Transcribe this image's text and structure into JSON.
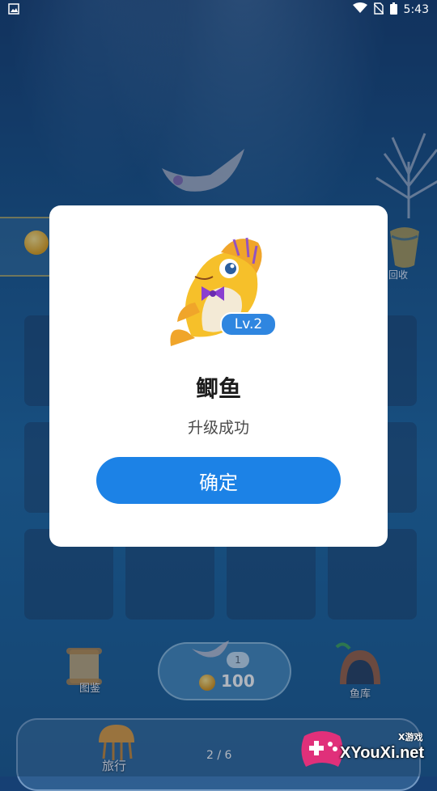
{
  "status_bar": {
    "time": "5:43",
    "icons": [
      "image-icon",
      "wifi-icon",
      "no-sim-icon",
      "battery-icon"
    ]
  },
  "background": {
    "recycle_label": "回收",
    "bottom_nav": {
      "collection_label": "图鉴",
      "buy_fish": {
        "count_badge": "1",
        "price": "100"
      },
      "storage_label": "鱼库",
      "travel_label": "旅行",
      "page_indicator": "2 / 6"
    }
  },
  "dialog": {
    "level_badge": "Lv.2",
    "fish_name": "鲫鱼",
    "message": "升级成功",
    "confirm_label": "确定"
  },
  "watermark": {
    "tag": "X游戏",
    "site": "XYouXi.net"
  },
  "colors": {
    "accent": "#1c82e6",
    "badge": "#2f86e0",
    "dialog_bg": "#ffffff",
    "ocean": "#1b5a93"
  }
}
